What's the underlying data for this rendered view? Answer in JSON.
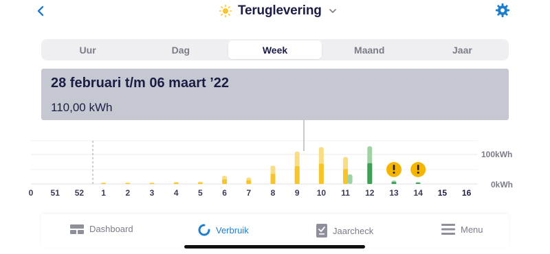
{
  "header": {
    "title": "Teruglevering",
    "back_icon": "chevron-left-icon",
    "title_icon": "sun-icon",
    "dropdown_icon": "chevron-down-icon",
    "settings_icon": "gear-icon"
  },
  "tabs": [
    {
      "label": "Uur",
      "active": false
    },
    {
      "label": "Dag",
      "active": false
    },
    {
      "label": "Week",
      "active": true
    },
    {
      "label": "Maand",
      "active": false
    },
    {
      "label": "Jaar",
      "active": false
    }
  ],
  "tooltip": {
    "period": "28 februari t/m 06 maart ’22",
    "value": "110,00 kWh"
  },
  "chart_data": {
    "type": "bar",
    "categories": [
      "0",
      "51",
      "52",
      "1",
      "2",
      "3",
      "4",
      "5",
      "6",
      "7",
      "8",
      "9",
      "10",
      "11",
      "12",
      "13",
      "14",
      "15",
      "16"
    ],
    "series": [
      {
        "values": [
          null,
          null,
          null,
          2,
          1,
          2,
          7,
          8,
          28,
          22,
          62,
          110,
          125,
          92,
          128,
          12,
          7,
          null,
          null
        ]
      }
    ],
    "bar_colors": [
      "yellow",
      "yellow",
      "yellow",
      "yellow",
      "yellow",
      "yellow",
      "yellow",
      "yellow",
      "yellow",
      "yellow",
      "yellow",
      "yellow",
      "yellow",
      "yellow",
      "green",
      "green",
      "green",
      "yellow",
      "yellow"
    ],
    "warnings_at": [
      "13",
      "14"
    ],
    "selected": "9",
    "year_divider_after": "52",
    "ylim": [
      0,
      100
    ],
    "y_ticks": [
      "100kWh",
      "0kWh"
    ],
    "grid": true
  },
  "colors": {
    "yellow": "#f6c52b",
    "green": "#3f9f55",
    "light_yellow": "#f8dd85",
    "light_green": "#9fd3a6",
    "warning": "#f4b400",
    "accent": "#1f7ecb",
    "navy": "#1b1d45"
  },
  "bottom_nav": [
    {
      "label": "Dashboard",
      "icon": "dashboard-icon",
      "active": false
    },
    {
      "label": "Verbruik",
      "icon": "usage-icon",
      "active": true
    },
    {
      "label": "Jaarcheck",
      "icon": "checklist-icon",
      "active": false
    },
    {
      "label": "Menu",
      "icon": "menu-icon",
      "active": false
    }
  ]
}
